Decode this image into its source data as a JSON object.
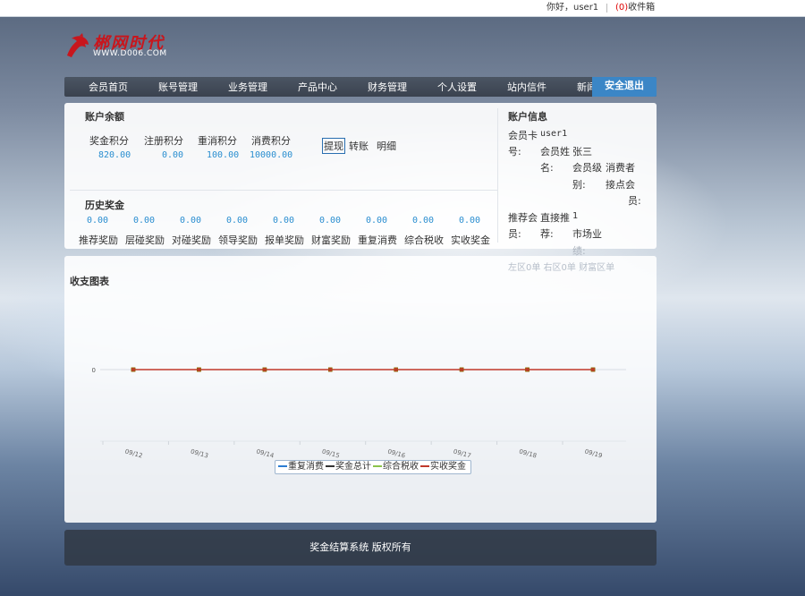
{
  "topbar": {
    "greeting": "你好，user1",
    "inbox_count": "(0)",
    "inbox_label": "收件箱"
  },
  "logo": {
    "title": "郴网时代",
    "url": "WWW.D006.COM"
  },
  "nav": {
    "items": [
      "会员首页",
      "账号管理",
      "业务管理",
      "产品中心",
      "财务管理",
      "个人设置",
      "站内信件",
      "新闻"
    ],
    "logout": "安全退出"
  },
  "balance": {
    "title": "账户余额",
    "items": [
      {
        "label": "奖金积分",
        "value": "820.00"
      },
      {
        "label": "注册积分",
        "value": "0.00"
      },
      {
        "label": "重消积分",
        "value": "100.00"
      },
      {
        "label": "消费积分",
        "value": "10000.00"
      }
    ],
    "actions": [
      "提现",
      "转账",
      "明细"
    ]
  },
  "history": {
    "title": "历史奖金",
    "items": [
      {
        "label": "推荐奖励",
        "value": "0.00"
      },
      {
        "label": "层碰奖励",
        "value": "0.00"
      },
      {
        "label": "对碰奖励",
        "value": "0.00"
      },
      {
        "label": "领导奖励",
        "value": "0.00"
      },
      {
        "label": "报单奖励",
        "value": "0.00"
      },
      {
        "label": "财富奖励",
        "value": "0.00"
      },
      {
        "label": "重复消费",
        "value": "0.00"
      },
      {
        "label": "综合税收",
        "value": "0.00"
      },
      {
        "label": "实收奖金",
        "value": "0.00"
      }
    ]
  },
  "info": {
    "title": "账户信息",
    "card_label_1": "会员卡",
    "card_label_2": "号:",
    "card_value": "user1",
    "name_label_1": "会员姓",
    "name_label_2": "名:",
    "name_value": "张三",
    "level_label_1": "会员级",
    "level_label_2": "别:",
    "level_value_1": "消费者",
    "level_value_2": "接点会",
    "level_value_3": "员:",
    "referrer_label_1": "推荐会",
    "referrer_label_2": "员:",
    "direct_label_1": "直接推",
    "direct_label_2": "荐:",
    "direct_value": "1",
    "market_label_1": "市场业",
    "market_label_2": "绩:",
    "zones": "左区0单 右区0单 财富区单"
  },
  "chart_data": {
    "type": "line",
    "title": "收支图表",
    "categories": [
      "09/12",
      "09/13",
      "09/14",
      "09/15",
      "09/16",
      "09/17",
      "09/18",
      "09/19"
    ],
    "y_ticks": [
      "0"
    ],
    "series": [
      {
        "name": "重复消费",
        "values": [
          0,
          0,
          0,
          0,
          0,
          0,
          0,
          0
        ],
        "color": "#2d7dd2"
      },
      {
        "name": "奖金总计",
        "values": [
          0,
          0,
          0,
          0,
          0,
          0,
          0,
          0
        ],
        "color": "#333333"
      },
      {
        "name": "综合税收",
        "values": [
          0,
          0,
          0,
          0,
          0,
          0,
          0,
          0
        ],
        "color": "#8bc34a"
      },
      {
        "name": "实收奖金",
        "values": [
          0,
          0,
          0,
          0,
          0,
          0,
          0,
          0
        ],
        "color": "#c0392b"
      }
    ]
  },
  "footer": {
    "text": "奖金结算系统 版权所有"
  }
}
